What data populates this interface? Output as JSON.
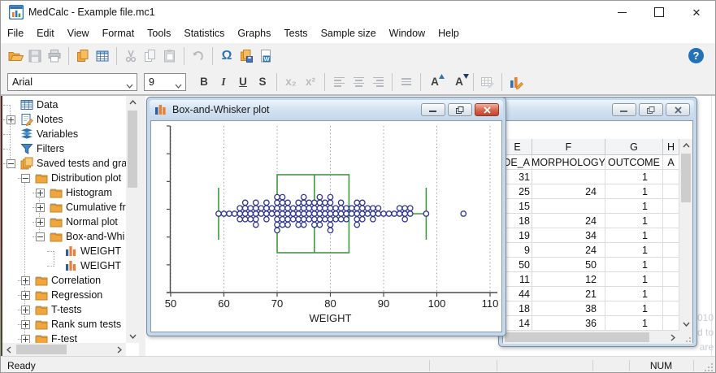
{
  "window": {
    "title": "MedCalc - Example file.mc1"
  },
  "menu": {
    "items": [
      "File",
      "Edit",
      "View",
      "Format",
      "Tools",
      "Statistics",
      "Graphs",
      "Tests",
      "Sample size",
      "Window",
      "Help"
    ]
  },
  "toolbar": {
    "icons": [
      "open-folder",
      "save",
      "print",
      "duplicate-sheet",
      "spreadsheet",
      "cut",
      "copy",
      "paste",
      "undo",
      "omega",
      "save-all",
      "export-word",
      "help"
    ],
    "omega": "Ω",
    "help": "?"
  },
  "format_bar": {
    "font": "Arial",
    "size": "9",
    "bold": "B",
    "italic": "I",
    "underline": "U",
    "strike": "S",
    "subscript": "x₂",
    "superscript": "x²",
    "font_up": "A",
    "font_down": "A"
  },
  "tree": {
    "items": [
      {
        "label": "Data",
        "level": 0,
        "expand": "",
        "icon": "table"
      },
      {
        "label": "Notes",
        "level": 0,
        "expand": "+",
        "icon": "notes"
      },
      {
        "label": "Variables",
        "level": 0,
        "expand": "",
        "icon": "variables"
      },
      {
        "label": "Filters",
        "level": 0,
        "expand": "",
        "icon": "filter"
      },
      {
        "label": "Saved tests and grap",
        "level": 0,
        "expand": "-",
        "icon": "stack"
      },
      {
        "label": "Distribution plot",
        "level": 1,
        "expand": "-",
        "icon": "folder"
      },
      {
        "label": "Histogram",
        "level": 2,
        "expand": "+",
        "icon": "folder"
      },
      {
        "label": "Cumulative fr",
        "level": 2,
        "expand": "+",
        "icon": "folder"
      },
      {
        "label": "Normal plot",
        "level": 2,
        "expand": "+",
        "icon": "folder"
      },
      {
        "label": "Box-and-Whi",
        "level": 2,
        "expand": "-",
        "icon": "folder"
      },
      {
        "label": "WEIGHT",
        "level": 3,
        "expand": "",
        "icon": "chart"
      },
      {
        "label": "WEIGHT",
        "level": 3,
        "expand": "",
        "icon": "chart"
      },
      {
        "label": "Correlation",
        "level": 1,
        "expand": "+",
        "icon": "folder"
      },
      {
        "label": "Regression",
        "level": 1,
        "expand": "+",
        "icon": "folder"
      },
      {
        "label": "T-tests",
        "level": 1,
        "expand": "+",
        "icon": "folder"
      },
      {
        "label": "Rank sum tests",
        "level": 1,
        "expand": "+",
        "icon": "folder"
      },
      {
        "label": "F-test",
        "level": 1,
        "expand": "+",
        "icon": "folder"
      }
    ]
  },
  "plot_window": {
    "title": "Box-and-Whisker plot"
  },
  "chart_data": {
    "type": "boxplot",
    "orientation": "horizontal",
    "title": "",
    "xlabel": "WEIGHT",
    "xlim": [
      50,
      110
    ],
    "xticks": [
      50,
      60,
      70,
      80,
      90,
      100,
      110
    ],
    "grid": "dotted-vertical",
    "box": {
      "lower_whisker": 59,
      "q1": 70,
      "median": 77,
      "q3": 83.5,
      "upper_whisker": 98,
      "outliers": [
        105
      ]
    },
    "values": [
      59,
      60,
      61,
      62,
      63,
      63,
      63,
      64,
      64,
      64,
      64,
      65,
      65,
      65,
      66,
      66,
      66,
      66,
      66,
      67,
      67,
      68,
      68,
      68,
      68,
      69,
      69,
      70,
      70,
      70,
      70,
      70,
      70,
      70,
      71,
      71,
      71,
      71,
      71,
      71,
      72,
      72,
      72,
      72,
      72,
      73,
      73,
      73,
      74,
      74,
      74,
      74,
      74,
      75,
      75,
      75,
      75,
      75,
      75,
      76,
      76,
      76,
      76,
      77,
      77,
      77,
      77,
      77,
      78,
      78,
      78,
      78,
      78,
      78,
      79,
      79,
      79,
      79,
      80,
      80,
      80,
      80,
      80,
      80,
      80,
      81,
      81,
      81,
      82,
      82,
      82,
      82,
      83,
      83,
      83,
      84,
      84,
      85,
      85,
      85,
      85,
      85,
      86,
      86,
      86,
      86,
      87,
      87,
      88,
      88,
      88,
      89,
      89,
      90,
      91,
      92,
      93,
      93,
      94,
      94,
      94,
      95,
      95,
      98,
      105
    ]
  },
  "sheet": {
    "columns": [
      "E",
      "F",
      "G",
      "H"
    ],
    "var_names": [
      "DE_A",
      "MORPHOLOGY",
      "OUTCOME",
      "A"
    ],
    "rows": [
      [
        "31",
        "",
        "1"
      ],
      [
        "25",
        "24",
        "1"
      ],
      [
        "15",
        "",
        "1"
      ],
      [
        "18",
        "24",
        "1"
      ],
      [
        "19",
        "34",
        "1"
      ],
      [
        "9",
        "24",
        "1"
      ],
      [
        "50",
        "50",
        "1"
      ],
      [
        "11",
        "12",
        "1"
      ],
      [
        "44",
        "21",
        "1"
      ],
      [
        "18",
        "38",
        "1"
      ],
      [
        "14",
        "36",
        "1"
      ]
    ]
  },
  "watermark": [
    "010",
    "d to",
    "are"
  ],
  "status": {
    "ready": "Ready",
    "num": "NUM"
  }
}
